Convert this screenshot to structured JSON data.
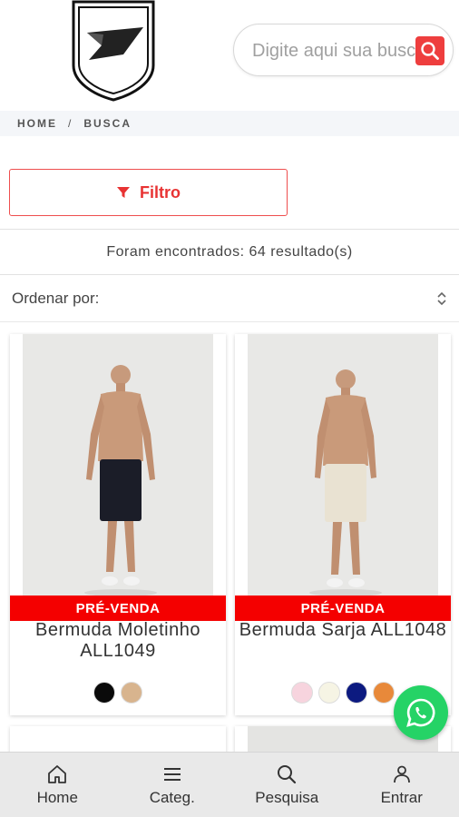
{
  "header": {
    "search_placeholder": "Digite aqui sua busca"
  },
  "breadcrumb": {
    "home": "HOME",
    "separator": "/",
    "current": "BUSCA"
  },
  "filter": {
    "label": "Filtro"
  },
  "results": {
    "text": "Foram encontrados: 64 resultado(s)"
  },
  "sort": {
    "label": "Ordenar por:"
  },
  "products": [
    {
      "badge": "PRÉ-VENDA",
      "name": "Bermuda Moletinho ALL1049",
      "colors": [
        "#0a0a0a",
        "#d8b48e"
      ],
      "shorts_color": "#1b1d28"
    },
    {
      "badge": "PRÉ-VENDA",
      "name": "Bermuda Sarja ALL1048",
      "colors": [
        "#f7d4de",
        "#f6f4e4",
        "#0c1a80",
        "#e8893a"
      ],
      "shorts_color": "#e9e2d2"
    }
  ],
  "colors": {
    "accent": "#ee3e3e",
    "badge": "#f40000",
    "whatsapp": "#25d366"
  },
  "bottom_nav": [
    {
      "label": "Home",
      "icon": "home-icon"
    },
    {
      "label": "Categ.",
      "icon": "menu-icon"
    },
    {
      "label": "Pesquisa",
      "icon": "search-icon"
    },
    {
      "label": "Entrar",
      "icon": "user-icon"
    }
  ]
}
